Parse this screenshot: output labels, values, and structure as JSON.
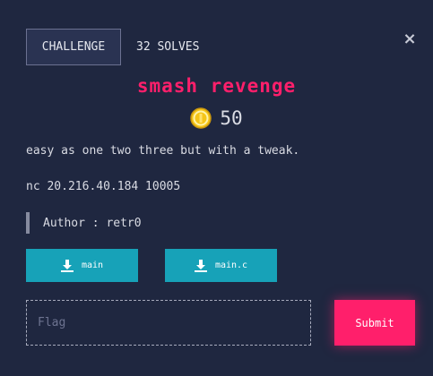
{
  "tabs": {
    "challenge": "CHALLENGE",
    "solves": "32 SOLVES"
  },
  "close_icon": "×",
  "challenge": {
    "name": "smash revenge",
    "points": "50",
    "description": "easy as one two three but with a tweak.",
    "connection": "nc 20.216.40.184 10005",
    "author": "Author : retr0"
  },
  "files": [
    {
      "label": "main",
      "icon": "download-icon"
    },
    {
      "label": "main.c",
      "icon": "download-icon"
    }
  ],
  "flag": {
    "placeholder": "Flag",
    "value": ""
  },
  "submit_label": "Submit",
  "colors": {
    "background": "#1f2740",
    "accent": "#ff1f6b",
    "file_button": "#17a2b8",
    "coin": "#f5c518"
  }
}
